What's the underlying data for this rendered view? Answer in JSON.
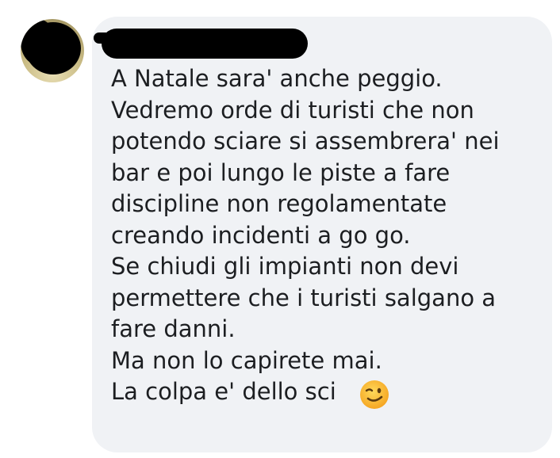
{
  "comment": {
    "author_name": "",
    "lines": [
      "A Natale sara' anche peggio.",
      "Vedremo orde di turisti che non",
      "potendo sciare si assembrera' nei",
      "bar e poi lungo le piste a fare",
      "discipline non regolamentate",
      "creando incidenti a go go.",
      "Se chiudi gli impianti non devi",
      "permettere che i turisti salgano a",
      "fare danni.",
      "Ma non lo capirete mai.",
      "La colpa e' dello sci"
    ],
    "emoji": "winking-face-emoji"
  },
  "colors": {
    "bubble_background": "#f0f2f5",
    "text": "#1c1e21",
    "emoji_face": "#fdc23c"
  }
}
